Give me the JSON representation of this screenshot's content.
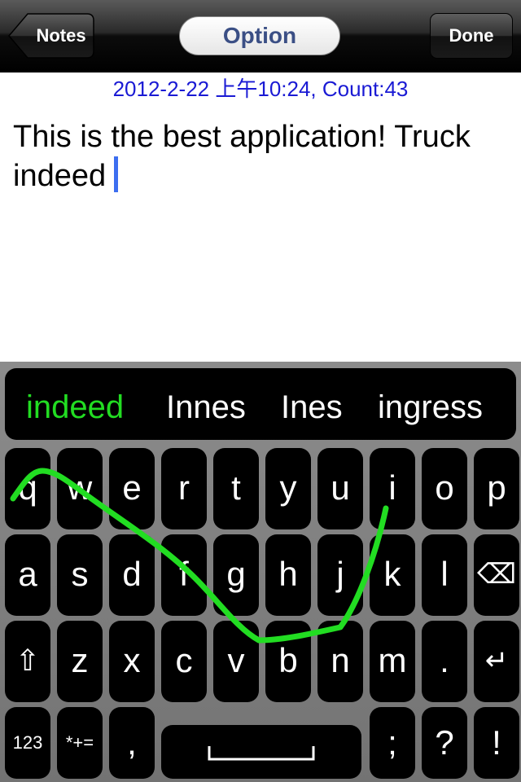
{
  "navbar": {
    "back_label": "Notes",
    "title": "Option",
    "done_label": "Done"
  },
  "note": {
    "timestamp": "2012-2-22 上午10:24, Count:43",
    "text": "This is the best application! Truck indeed"
  },
  "keyboard": {
    "suggestions": [
      "indeed",
      "Innes",
      "Ines",
      "ingress"
    ],
    "active_suggestion": "indeed",
    "row1": [
      "q",
      "w",
      "e",
      "r",
      "t",
      "y",
      "u",
      "i",
      "o",
      "p"
    ],
    "row2": [
      "a",
      "s",
      "d",
      "f",
      "g",
      "h",
      "j",
      "k",
      "l",
      "⌫"
    ],
    "row3": [
      "⇧",
      "z",
      "x",
      "c",
      "v",
      "b",
      "n",
      "m",
      ".",
      "↵"
    ],
    "row4_left": [
      "123",
      "*+="
    ],
    "row4_comma": ",",
    "row4_right": [
      ";",
      "?",
      "!"
    ],
    "swipe_color": "#22dd22"
  }
}
